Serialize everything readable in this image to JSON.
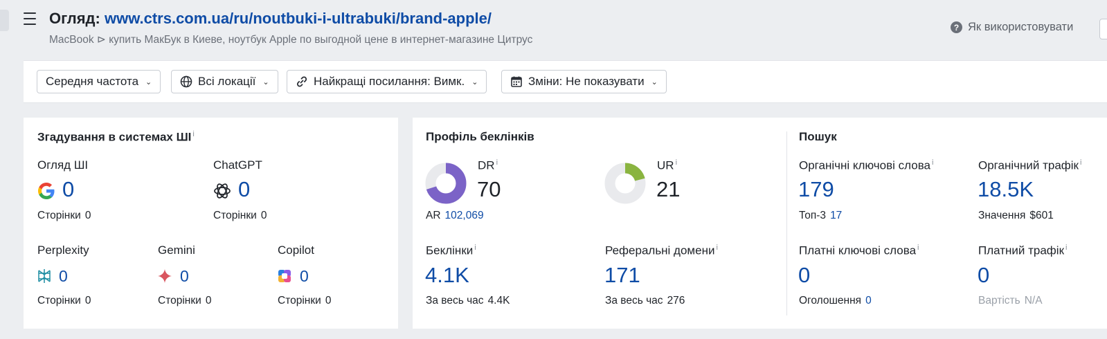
{
  "header": {
    "title_prefix": "Огляд:",
    "title_url": "www.ctrs.com.ua/ru/noutbuki-i-ultrabuki/brand-apple/",
    "subtitle": "MacBook ⊳ купить МакБук в Киеве, ноутбук Apple по выгодной цене в интернет-магазине Цитрус",
    "help_label": "Як використовувати"
  },
  "filters": [
    {
      "label": "Середня частота",
      "icon": ""
    },
    {
      "label": "Всі локації",
      "icon": "globe-icon"
    },
    {
      "label": "Найкращі посилання: Вимк.",
      "icon": "link-icon"
    },
    {
      "label": "Зміни: Не показувати",
      "icon": "calendar-icon"
    }
  ],
  "ai_mentions": {
    "title": "Згадування в системах ШІ",
    "info": "i",
    "pages_label": "Сторінки",
    "items": [
      {
        "name": "Огляд ШІ",
        "icon": "google-icon",
        "value": "0",
        "pages": "0"
      },
      {
        "name": "ChatGPT",
        "icon": "chatgpt-icon",
        "value": "0",
        "pages": "0"
      },
      {
        "name": "Perplexity",
        "icon": "perplexity-icon",
        "value": "0",
        "pages": "0"
      },
      {
        "name": "Gemini",
        "icon": "gemini-icon",
        "value": "0",
        "pages": "0"
      },
      {
        "name": "Copilot",
        "icon": "copilot-icon",
        "value": "0",
        "pages": "0"
      }
    ]
  },
  "backlinks": {
    "title": "Профіль беклінків",
    "dr": {
      "label": "DR",
      "value": "70",
      "fill": 70,
      "color": "#7b63c7"
    },
    "ur": {
      "label": "UR",
      "value": "21",
      "fill": 21,
      "color": "#8ab440"
    },
    "ar": {
      "label": "AR",
      "value": "102,069"
    },
    "backlinks": {
      "label": "Беклінки",
      "value": "4.1K",
      "sub_label": "За весь час",
      "sub_value": "4.4K"
    },
    "ref_domains": {
      "label": "Реферальні домени",
      "value": "171",
      "sub_label": "За весь час",
      "sub_value": "276"
    }
  },
  "search": {
    "title": "Пошук",
    "organic_keywords": {
      "label": "Органічні ключові слова",
      "value": "179",
      "sub_label": "Топ-3",
      "sub_value": "17"
    },
    "organic_traffic": {
      "label": "Органічний трафік",
      "value": "18.5K",
      "sub_label": "Значення",
      "sub_value": "$601"
    },
    "paid_keywords": {
      "label": "Платні ключові слова",
      "value": "0",
      "sub_label": "Оголошення",
      "sub_value": "0"
    },
    "paid_traffic": {
      "label": "Платний трафік",
      "value": "0",
      "sub_label": "Вартість",
      "sub_value": "N/A"
    }
  },
  "colors": {
    "accent": "#0f4ca6",
    "dr": "#7b63c7",
    "ur": "#8ab440",
    "track": "#e9eaed"
  }
}
